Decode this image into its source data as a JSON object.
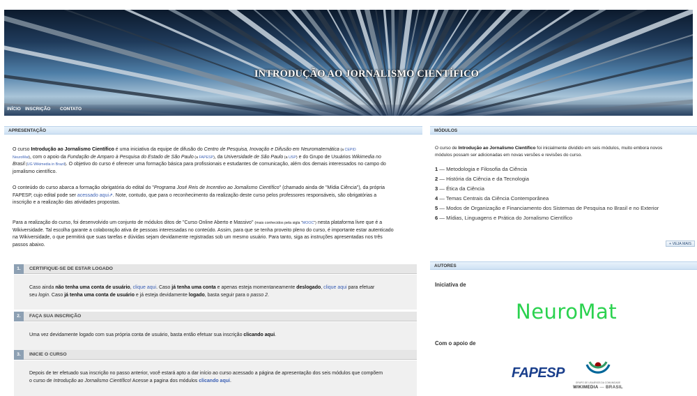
{
  "banner": {
    "title": "INTRODUÇÃO AO JORNALISMO CIENTÍFICO",
    "nav": [
      "INÍCIO",
      "INSCRIÇÃO",
      "CONTATO"
    ]
  },
  "apresentacao": {
    "header": "APRESENTAÇÃO",
    "p1": [
      [
        "O curso ",
        "n"
      ],
      [
        "Introdução ao Jornalismo Científico",
        "b"
      ],
      [
        " é uma iniciativa da equipe de difusão do ",
        "n"
      ],
      [
        "Centro de Pesquisa, Inovação e Difusão em Neuromatemática",
        "i"
      ],
      [
        " (a ",
        "s"
      ],
      [
        "CEPID",
        "sa"
      ],
      [
        "",
        "br"
      ],
      [
        "NeuroMat",
        "sa"
      ],
      [
        ")",
        "s"
      ],
      [
        ", com o apoio da ",
        "n"
      ],
      [
        "Fundação de Amparo à Pesquisa do Estado de São Paulo",
        "i"
      ],
      [
        " (a ",
        "s"
      ],
      [
        "FAPESP",
        "sa"
      ],
      [
        ")",
        "s"
      ],
      [
        ", da ",
        "n"
      ],
      [
        "Universidade de São Paulo",
        "i"
      ],
      [
        " (a ",
        "s"
      ],
      [
        "USP",
        "sa"
      ],
      [
        ")",
        "s"
      ],
      [
        " e do Grupo de Usuários ",
        "n"
      ],
      [
        "Wikimedia",
        "i"
      ],
      [
        " no",
        "i"
      ],
      [
        "",
        "br"
      ],
      [
        "Brasil",
        "i"
      ],
      [
        " (",
        "s"
      ],
      [
        "UG Wikimedia in Brazil",
        "sa"
      ],
      [
        ")",
        "s"
      ],
      [
        ". O objetivo do curso é oferecer uma formação básica para profissionais e estudantes de comunicação, além dos demais interessados no campo do",
        "n"
      ],
      [
        "",
        "br"
      ],
      [
        "jornalismo científico.",
        "n"
      ]
    ],
    "p2": [
      [
        "O conteúdo do curso abarca a formação obrigatória do edital do \"",
        "n"
      ],
      [
        "Programa José Reis de Incentivo ao Jornalismo Científico",
        "i"
      ],
      [
        "\" (chamado ainda de \"Mídia Ciência\"), da própria",
        "n"
      ],
      [
        "",
        "br"
      ],
      [
        "FAPESP, cujo edital pode ser ",
        "n"
      ],
      [
        "acessado aqui",
        "a"
      ],
      [
        "⇗",
        "a"
      ],
      [
        ". Note, contudo, que para o reconhecimento da realização deste curso pelos professores responsáveis, são obrigatórias a",
        "n"
      ],
      [
        "",
        "br"
      ],
      [
        "inscrição e a realização das atividades propostas.",
        "n"
      ]
    ],
    "p3": [
      [
        "Para a realização do curso, foi desenvolvido um conjunto de módulos ditos de \"Curso Online Aberto e Massivo\" ",
        "n"
      ],
      [
        "(mais conhecidos pela sigla \"",
        "s"
      ],
      [
        "MOOC",
        "sa"
      ],
      [
        "\")",
        "s"
      ],
      [
        " nesta plataforma livre que é a",
        "n"
      ],
      [
        "",
        "br"
      ],
      [
        "Wikiversidade. Tal escolha garante a colaboração ativa de pessoas interessadas no conteúdo. Assim, para que se tenha proveito pleno do curso, é importante estar autenticado",
        "n"
      ],
      [
        "",
        "br"
      ],
      [
        "na Wikiversidade, o que permitirá que suas tarefas e dúvidas sejam devidamente registradas sob um mesmo usuário. Para tanto, siga as instruções apresentadas nos três",
        "n"
      ],
      [
        "",
        "br"
      ],
      [
        "passos abaixo.",
        "n"
      ]
    ],
    "steps": [
      {
        "num": "1.",
        "title": "CERTIFIQUE-SE DE ESTAR LOGADO",
        "body": [
          [
            "Caso ainda ",
            "n"
          ],
          [
            "não tenha uma conta de usuário",
            "b"
          ],
          [
            ", ",
            "n"
          ],
          [
            "clique aqui",
            "a"
          ],
          [
            ". Caso ",
            "n"
          ],
          [
            "já tenha uma conta",
            "b"
          ],
          [
            " e apenas esteja momentaneamente ",
            "n"
          ],
          [
            "deslogado",
            "b"
          ],
          [
            ", ",
            "n"
          ],
          [
            "clique aqui",
            "a"
          ],
          [
            " para efetuar",
            "n"
          ],
          [
            "",
            "br"
          ],
          [
            "seu ",
            "n"
          ],
          [
            "login",
            "i"
          ],
          [
            ". Caso ",
            "n"
          ],
          [
            "já tenha uma conta de usuário",
            "b"
          ],
          [
            " e já esteja devidamente ",
            "n"
          ],
          [
            "logado",
            "b"
          ],
          [
            ", basta seguir para o ",
            "n"
          ],
          [
            "passo 2",
            "i"
          ],
          [
            ".",
            "n"
          ]
        ]
      },
      {
        "num": "2.",
        "title": "FAÇA SUA INSCRIÇÃO",
        "body": [
          [
            "Uma vez devidamente logado com sua própria conta de usuário, basta então efetuar sua inscrição ",
            "n"
          ],
          [
            "clicando aqui",
            "b"
          ],
          [
            ".",
            "n"
          ]
        ]
      },
      {
        "num": "3.",
        "title": "INICIE O CURSO",
        "body": [
          [
            "Depois de ter efetuado sua inscrição no passo anterior, você estará apto a dar início ao curso acessado a página de apresentação dos seis módulos que compõem",
            "n"
          ],
          [
            "",
            "br"
          ],
          [
            "o curso de ",
            "n"
          ],
          [
            "Introdução ao Jornalismo Científico",
            "i"
          ],
          [
            "! Acesse a pagina dos módulos ",
            "n"
          ],
          [
            "clicando aqui",
            "ab"
          ],
          [
            ".",
            "n"
          ]
        ]
      }
    ]
  },
  "modulos": {
    "header": "MÓDULOS",
    "intro": [
      [
        "O curso de ",
        "n"
      ],
      [
        "Introdução ao Jornalismo Científico",
        "b"
      ],
      [
        " foi inicialmente dividido em seis módulos, muito embora novos",
        "n"
      ],
      [
        "",
        "br"
      ],
      [
        "módulos possam ser adicionadas em novas versões e revisões do curso.",
        "n"
      ]
    ],
    "items": [
      {
        "num": "1",
        "label": "Metodologia e Filosofia da Ciência"
      },
      {
        "num": "2",
        "label": "História da Ciência e da Tecnologia"
      },
      {
        "num": "3",
        "label": "Ética da Ciência"
      },
      {
        "num": "4",
        "label": "Temas Centrais da Ciência Contemporânea"
      },
      {
        "num": "5",
        "label": "Modos de Organização e Financiamento dos Sistemas de Pesquisa no Brasil e no Exterior"
      },
      {
        "num": "6",
        "label": "Mídias, Linguagens e Prática do Jornalismo Científico"
      }
    ],
    "more_label": "+ VEJA MAIS"
  },
  "autores": {
    "header": "AUTORES",
    "iniciativa": "Iniciativa de",
    "neuromat": "NeuroMat",
    "apoio": "Com o apoio de",
    "fapesp": "FAPESP",
    "wm_small": "GRUPO DE USUÁRIOS DA COMUNIDADE",
    "wm_big": "WIKIMEDIA",
    "wm_brasil": "BRASIL"
  },
  "colors": {
    "accent_link": "#3a5fb4",
    "neuromat": "#2bd24f",
    "fapesp": "#1a3f8c",
    "header_bg": "#d6e7f7"
  }
}
